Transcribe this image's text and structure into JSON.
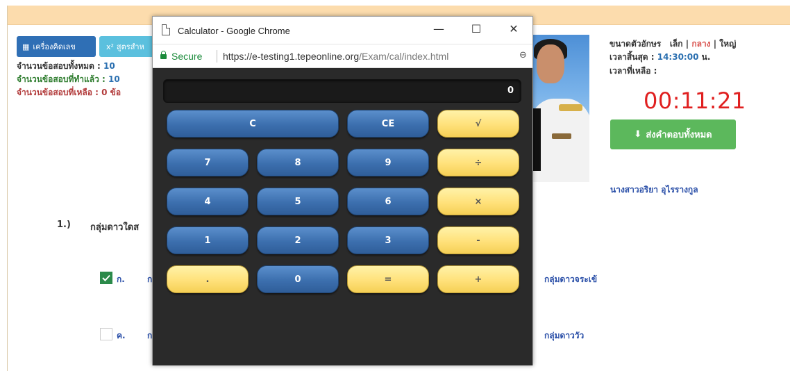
{
  "toolbar": {
    "calculator_label": "เครื่องคิดเลข",
    "formula_label": "สูตรสำห",
    "formula_prefix": "x²"
  },
  "stats": {
    "total_label": "จำนวนข้อสอบทั้งหมด : ",
    "total_value": "10",
    "done_label": "จำนวนข้อสอบที่ทำแล้ว : ",
    "done_value": "10",
    "remaining_label": "จำนวนข้อสอบที่เหลือ : ",
    "remaining_value": "0 ข้อ"
  },
  "info": {
    "font_size_label": "ขนาดตัวอักษร",
    "font_small": "เล็ก",
    "font_medium": "กลาง",
    "font_large": "ใหญ่",
    "end_time_label": "เวลาสิ้นสุด : ",
    "end_time_value": "14:30:00",
    "end_time_unit": " น.",
    "time_left_label": "เวลาที่เหลือ :",
    "countdown": "00:11:21",
    "submit_label": "ส่งคำตอบทั้งหมด",
    "student_name": "นางสาวอริยา อุไรรางกูล"
  },
  "question": {
    "number": "1.)",
    "text": "กลุ่มดาวใดส",
    "options": [
      {
        "label": "ก.",
        "stub": "ก",
        "right": "กลุ่มดาวจระเข้",
        "checked": true
      },
      {
        "label": "ค.",
        "stub": "ก",
        "right": "กลุ่มดาววัว",
        "checked": false
      }
    ]
  },
  "chrome": {
    "title": "Calculator - Google Chrome",
    "minimize": "—",
    "maximize": "☐",
    "close": "✕",
    "secure": "Secure",
    "url_main": "https://e-testing1.tepeonline.org",
    "url_path": "/Exam/cal/index.html"
  },
  "calculator": {
    "display": "0",
    "keys": {
      "c": "C",
      "ce": "CE",
      "sqrt": "√",
      "k7": "7",
      "k8": "8",
      "k9": "9",
      "div": "÷",
      "k4": "4",
      "k5": "5",
      "k6": "6",
      "mul": "×",
      "k1": "1",
      "k2": "2",
      "k3": "3",
      "sub": "-",
      "dot": ".",
      "k0": "0",
      "eq": "=",
      "add": "+"
    }
  },
  "colors": {
    "accent_blue": "#2f6fb5",
    "success_green": "#5cb85c",
    "countdown_red": "#e02020",
    "key_blue": "#3c6fae",
    "key_yellow": "#ffe17a"
  }
}
